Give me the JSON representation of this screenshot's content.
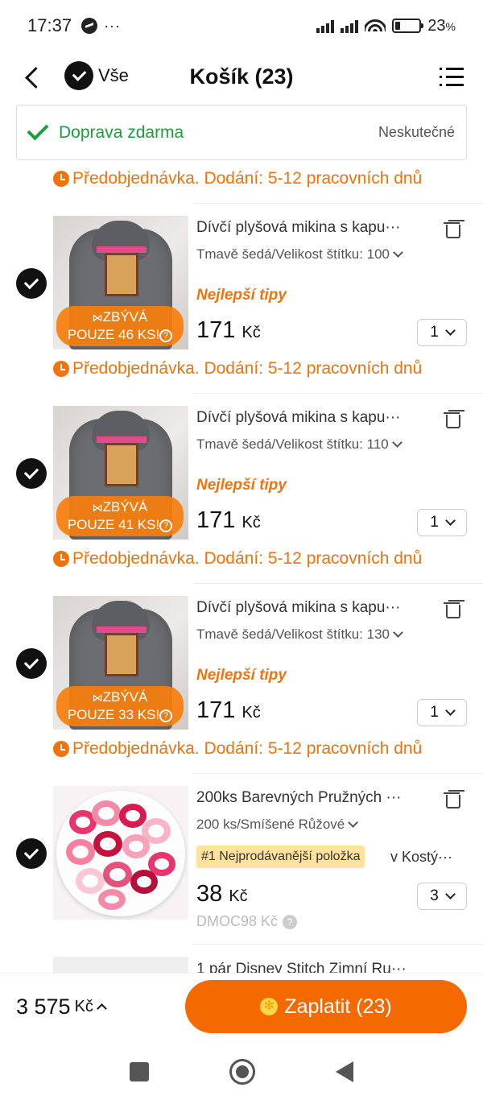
{
  "status_bar": {
    "time": "17:37",
    "dots": "···",
    "battery": "23",
    "battery_unit": "%",
    "battery_level": 0.23
  },
  "header": {
    "select_all_label": "Vše",
    "title": "Košík (23)"
  },
  "shipping": {
    "label": "Doprava zdarma",
    "status": "Neskutečné"
  },
  "preorder_text": "Předobjednávka. Dodání: 5-12 pracovních dnů",
  "items": [
    {
      "title": "Dívčí plyšová mikina s kapu",
      "variant": "Tmavě šedá/Velikost štítku: 100",
      "tag": "Nejlepší tipy",
      "stock_line1": "ZBÝVÁ",
      "stock_line2": "POUZE 46 KS!",
      "price": "171",
      "currency": "Kč",
      "qty": "1",
      "more": "···"
    },
    {
      "title": "Dívčí plyšová mikina s kapu",
      "variant": "Tmavě šedá/Velikost štítku: 110",
      "tag": "Nejlepší tipy",
      "stock_line1": "ZBÝVÁ",
      "stock_line2": "POUZE 41 KS!",
      "price": "171",
      "currency": "Kč",
      "qty": "1",
      "more": "···"
    },
    {
      "title": "Dívčí plyšová mikina s kapu",
      "variant": "Tmavě šedá/Velikost štítku: 130",
      "tag": "Nejlepší tipy",
      "stock_line1": "ZBÝVÁ",
      "stock_line2": "POUZE 33 KS!",
      "price": "171",
      "currency": "Kč",
      "qty": "1",
      "more": "···"
    },
    {
      "title": "200ks Barevných Pružných",
      "variant": "200 ks/Smíšené Růžové",
      "best_badge": "#1 Nejprodávanější položka",
      "category": "v Kostý",
      "price": "38",
      "currency": "Kč",
      "old_price": "DMOC98 Kč",
      "qty": "3",
      "more": "···"
    }
  ],
  "partial_item": {
    "title": "1 pár Disney Stitch Zimní Ru",
    "more": "···"
  },
  "footer": {
    "total": "3 575",
    "currency": "Kč",
    "pay_label": "Zaplatit (23)"
  },
  "colors": {
    "accent": "#f56a00",
    "preorder": "#f2720c",
    "free_shipping": "#1b9e3b"
  }
}
